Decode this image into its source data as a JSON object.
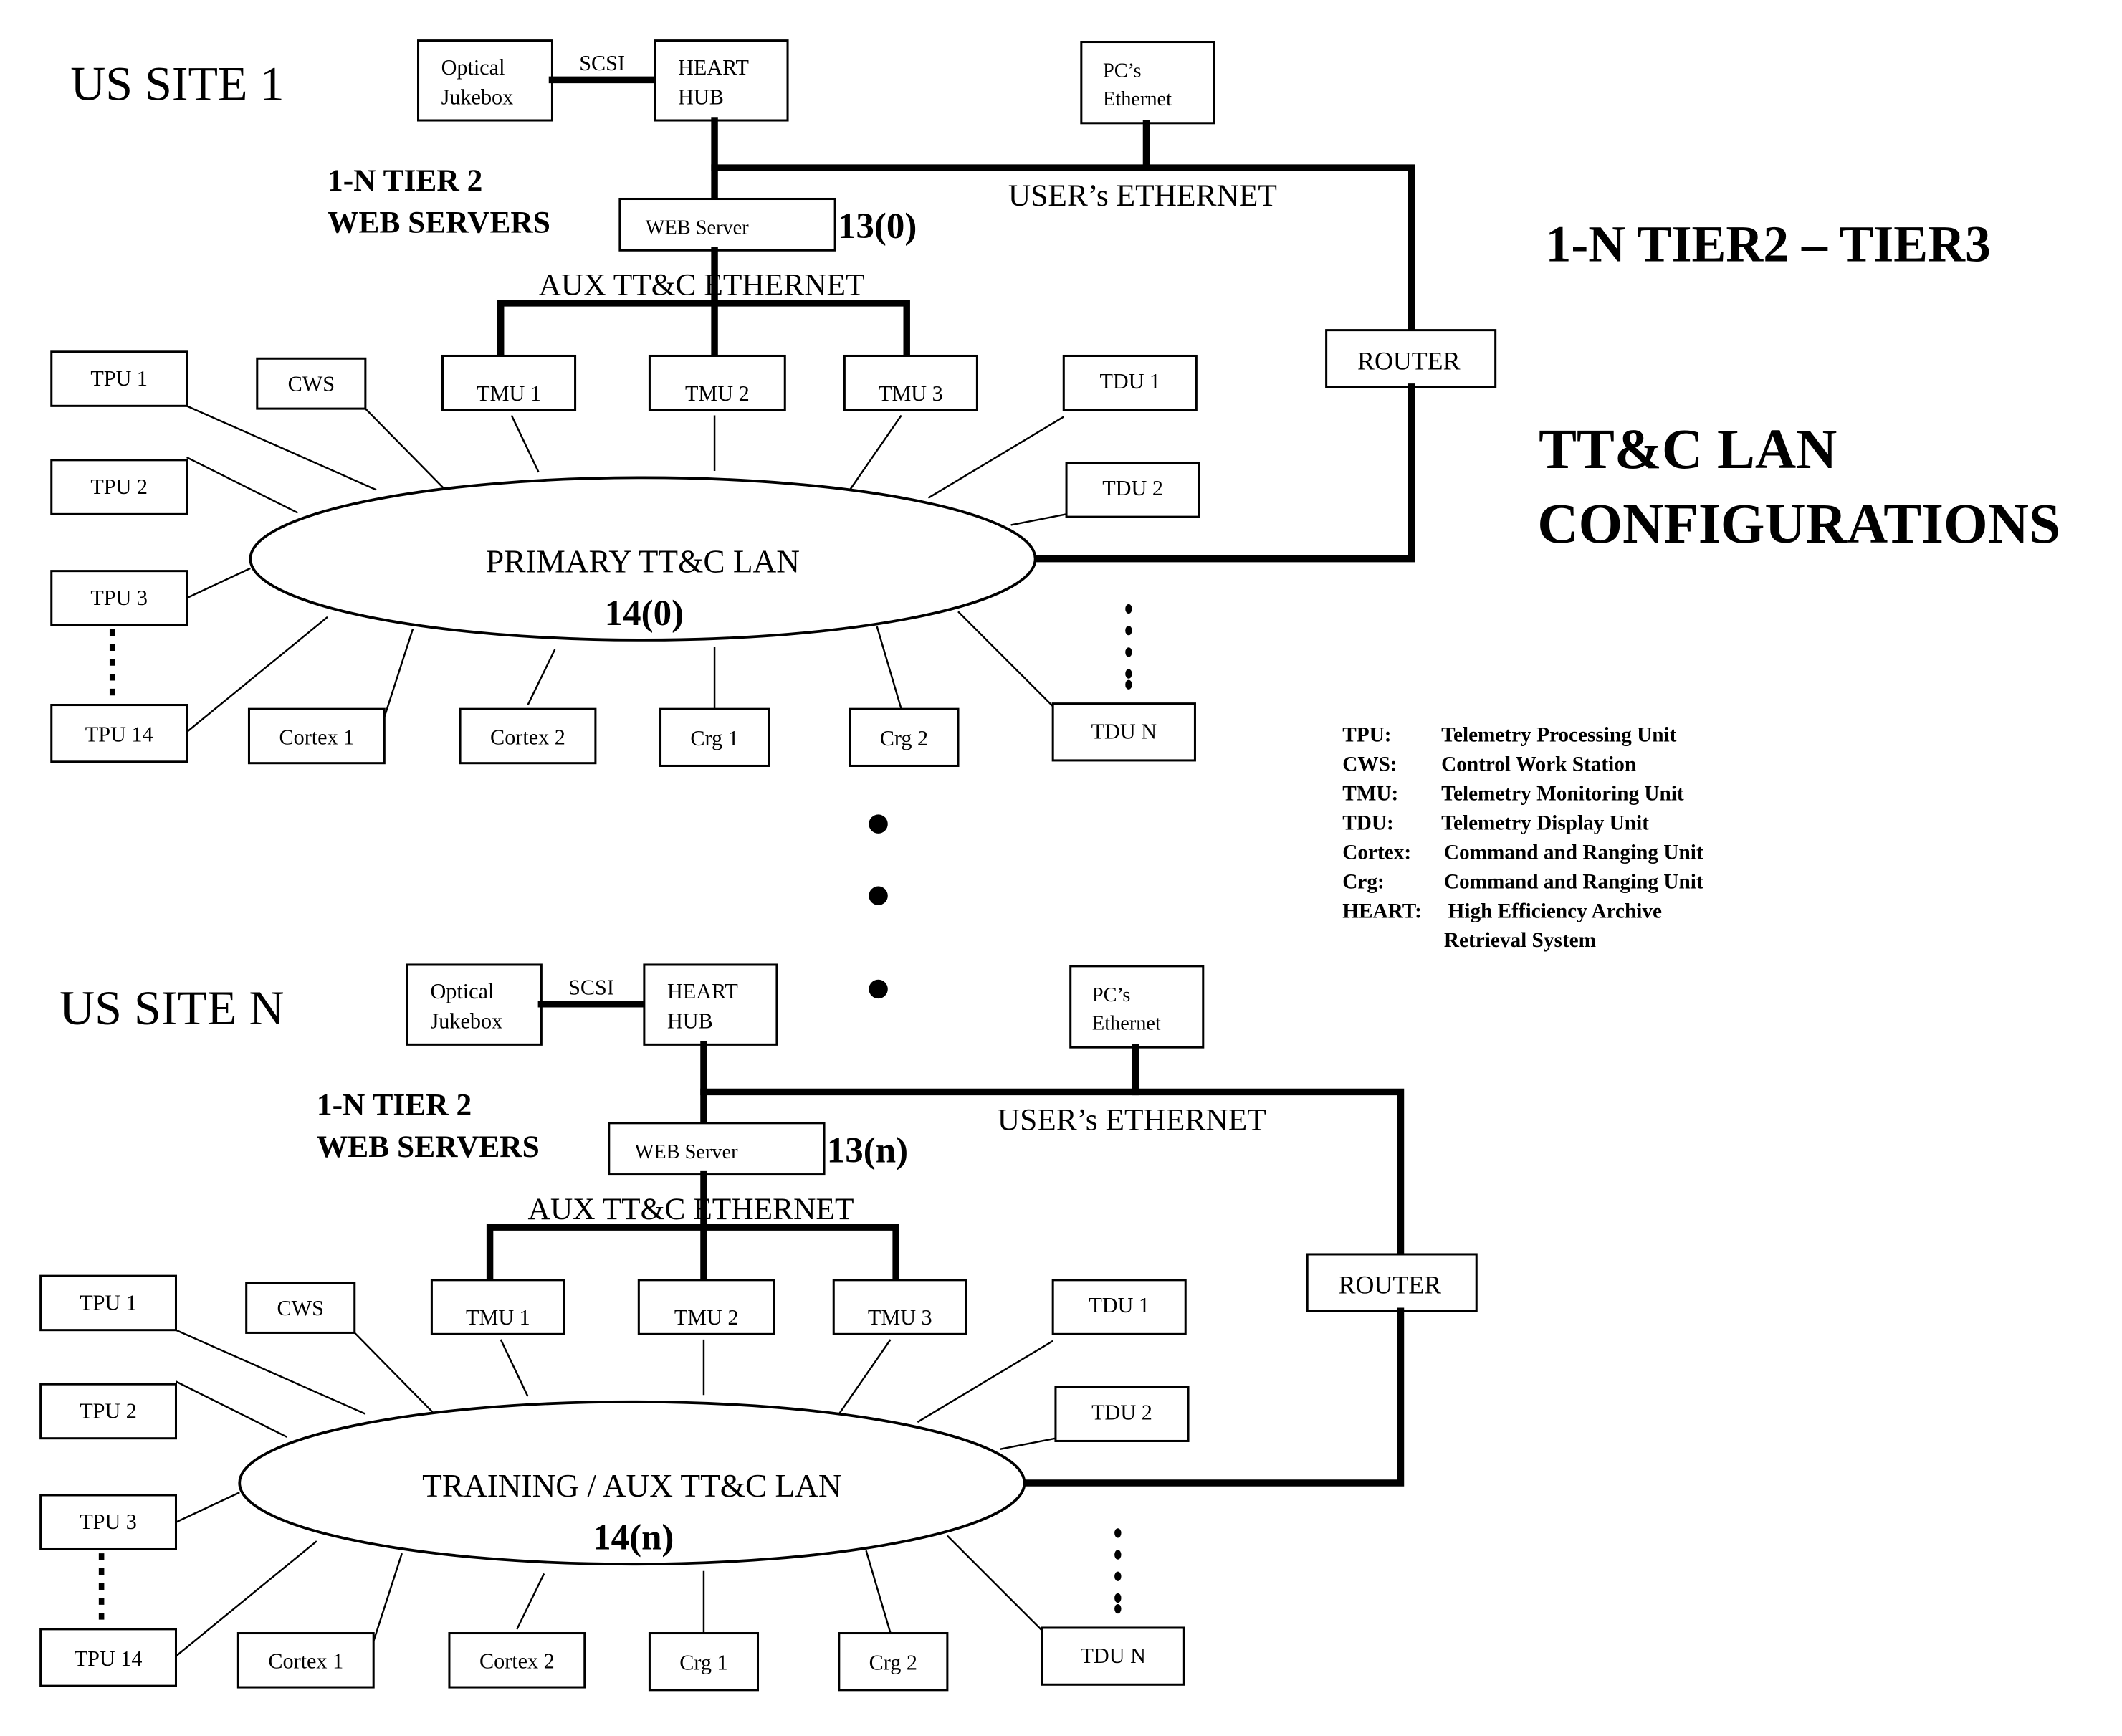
{
  "title": {
    "line1": "1-N TIER2 – TIER3",
    "line2": "TT&C LAN",
    "line3": "CONFIGURATIONS"
  },
  "legend": [
    {
      "abbr": "TPU:",
      "meaning": "Telemetry Processing Unit"
    },
    {
      "abbr": "CWS:",
      "meaning": "Control Work Station"
    },
    {
      "abbr": "TMU:",
      "meaning": "Telemetry Monitoring Unit"
    },
    {
      "abbr": "TDU:",
      "meaning": "Telemetry Display Unit"
    },
    {
      "abbr": "Cortex:",
      "meaning": "Command and Ranging Unit"
    },
    {
      "abbr": "Crg:",
      "meaning": "Command and Ranging Unit"
    },
    {
      "abbr": "HEART:",
      "meaning": "High Efficiency Archive",
      "meaning2": "Retrieval System"
    }
  ],
  "sites": [
    {
      "site_label": "US SITE 1",
      "jukebox": [
        "Optical",
        "Jukebox"
      ],
      "scsi_label": "SCSI",
      "heart": [
        "HEART",
        "HUB"
      ],
      "pcs": [
        "PC’s",
        "Ethernet"
      ],
      "users_ethernet": "USER’s ETHERNET",
      "tier2_label": [
        "1-N TIER 2",
        "WEB SERVERS"
      ],
      "web_server": "WEB Server",
      "web_server_id": "13(0)",
      "aux_ethernet": "AUX TT&C ETHERNET",
      "router": "ROUTER",
      "lan_name": "PRIMARY TT&C LAN",
      "lan_id": "14(0)",
      "nodes": [
        "TPU 1",
        "CWS",
        "TMU 1",
        "TMU 2",
        "TMU 3",
        "TDU 1",
        "TPU 2",
        "TDU 2",
        "TPU 3",
        "TPU 14",
        "Cortex 1",
        "Cortex 2",
        "Crg 1",
        "Crg 2",
        "TDU N"
      ]
    },
    {
      "site_label": "US SITE N",
      "jukebox": [
        "Optical",
        "Jukebox"
      ],
      "scsi_label": "SCSI",
      "heart": [
        "HEART",
        "HUB"
      ],
      "pcs": [
        "PC’s",
        "Ethernet"
      ],
      "users_ethernet": "USER’s ETHERNET",
      "tier2_label": [
        "1-N TIER 2",
        "WEB SERVERS"
      ],
      "web_server": "WEB Server",
      "web_server_id": "13(n)",
      "aux_ethernet": "AUX TT&C ETHERNET",
      "router": "ROUTER",
      "lan_name": "TRAINING / AUX TT&C LAN",
      "lan_id": "14(n)",
      "nodes": [
        "TPU 1",
        "CWS",
        "TMU 1",
        "TMU 2",
        "TMU 3",
        "TDU 1",
        "TPU 2",
        "TDU 2",
        "TPU 3",
        "TPU 14",
        "Cortex 1",
        "Cortex 2",
        "Crg 1",
        "Crg 2",
        "TDU N"
      ]
    }
  ]
}
